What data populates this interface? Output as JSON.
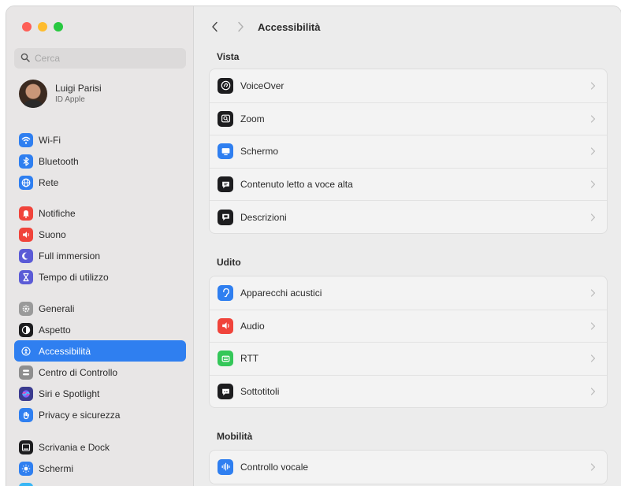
{
  "search": {
    "placeholder": "Cerca"
  },
  "profile": {
    "name": "Luigi Parisi",
    "subtitle": "ID Apple"
  },
  "sidebar": {
    "groups": [
      [
        {
          "label": "Wi-Fi",
          "icon": "wifi-icon",
          "color": "#2f7ff0"
        },
        {
          "label": "Bluetooth",
          "icon": "bluetooth-icon",
          "color": "#2f7ff0"
        },
        {
          "label": "Rete",
          "icon": "globe-icon",
          "color": "#2f7ff0"
        }
      ],
      [
        {
          "label": "Notifiche",
          "icon": "bell-icon",
          "color": "#f0443b"
        },
        {
          "label": "Suono",
          "icon": "speaker-icon",
          "color": "#f0443b"
        },
        {
          "label": "Full immersion",
          "icon": "moon-icon",
          "color": "#5b5bd6"
        },
        {
          "label": "Tempo di utilizzo",
          "icon": "hourglass-icon",
          "color": "#5b5bd6"
        }
      ],
      [
        {
          "label": "Generali",
          "icon": "gear-icon",
          "color": "#9a9a9a"
        },
        {
          "label": "Aspetto",
          "icon": "appearance-icon",
          "color": "#1d1d1f"
        },
        {
          "label": "Accessibilità",
          "icon": "accessibility-icon",
          "color": "#2f7ff0",
          "active": true
        },
        {
          "label": "Centro di Controllo",
          "icon": "control-center-icon",
          "color": "#8e8e8e"
        },
        {
          "label": "Siri e Spotlight",
          "icon": "siri-icon",
          "color": "#3b3b8f"
        },
        {
          "label": "Privacy e sicurezza",
          "icon": "hand-icon",
          "color": "#2f7ff0"
        }
      ],
      [
        {
          "label": "Scrivania e Dock",
          "icon": "dock-icon",
          "color": "#1d1d1f"
        },
        {
          "label": "Schermi",
          "icon": "sun-icon",
          "color": "#2f7ff0"
        },
        {
          "label": "Sfondo",
          "icon": "wallpaper-icon",
          "color": "#38b6f5"
        }
      ]
    ]
  },
  "main": {
    "title": "Accessibilità",
    "sections": [
      {
        "title": "Vista",
        "rows": [
          {
            "label": "VoiceOver",
            "icon": "voiceover-icon",
            "color": "#1d1d1f"
          },
          {
            "label": "Zoom",
            "icon": "zoom-icon",
            "color": "#1d1d1f"
          },
          {
            "label": "Schermo",
            "icon": "display-icon",
            "color": "#2f7ff0"
          },
          {
            "label": "Contenuto letto a voce alta",
            "icon": "speech-bubble-icon",
            "color": "#1d1d1f"
          },
          {
            "label": "Descrizioni",
            "icon": "descriptions-icon",
            "color": "#1d1d1f"
          }
        ]
      },
      {
        "title": "Udito",
        "rows": [
          {
            "label": "Apparecchi acustici",
            "icon": "ear-icon",
            "color": "#2f7ff0"
          },
          {
            "label": "Audio",
            "icon": "speaker-icon",
            "color": "#f0443b"
          },
          {
            "label": "RTT",
            "icon": "rtt-icon",
            "color": "#34c759"
          },
          {
            "label": "Sottotitoli",
            "icon": "captions-icon",
            "color": "#1d1d1f"
          }
        ]
      },
      {
        "title": "Mobilità",
        "rows": [
          {
            "label": "Controllo vocale",
            "icon": "waveform-icon",
            "color": "#2f7ff0"
          }
        ]
      }
    ]
  }
}
